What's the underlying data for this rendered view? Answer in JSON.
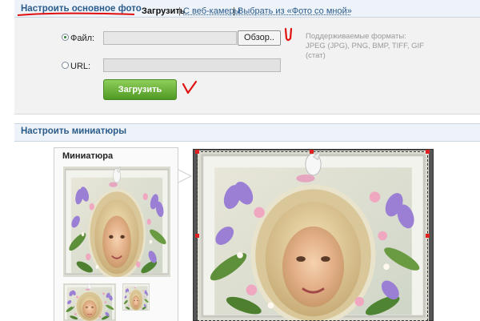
{
  "section_main": {
    "title": "Настроить основное фото",
    "tabs": {
      "upload": "Загрузить",
      "webcam": "С веб-камеры",
      "from_photos": "Выбрать из «Фото со мной»"
    },
    "separator": "|"
  },
  "upload_form": {
    "file_label": "Файл:",
    "file_value": "",
    "browse_button": "Обзор..",
    "url_label": "URL:",
    "url_value": "",
    "formats_text": "Поддерживаемые форматы: JPEG (JPG), PNG, BMP, TIFF, GIF (стат)",
    "submit_button": "Загрузить",
    "file_selected": true
  },
  "section_thumbnail": {
    "title": "Настроить миниатюры",
    "thumbnail_label": "Миниатюра"
  },
  "annotations": {
    "color": "#e01010"
  },
  "colors": {
    "link": "#2a5b8a",
    "button_green": "#5fae30",
    "crop_handle": "#e02020"
  }
}
